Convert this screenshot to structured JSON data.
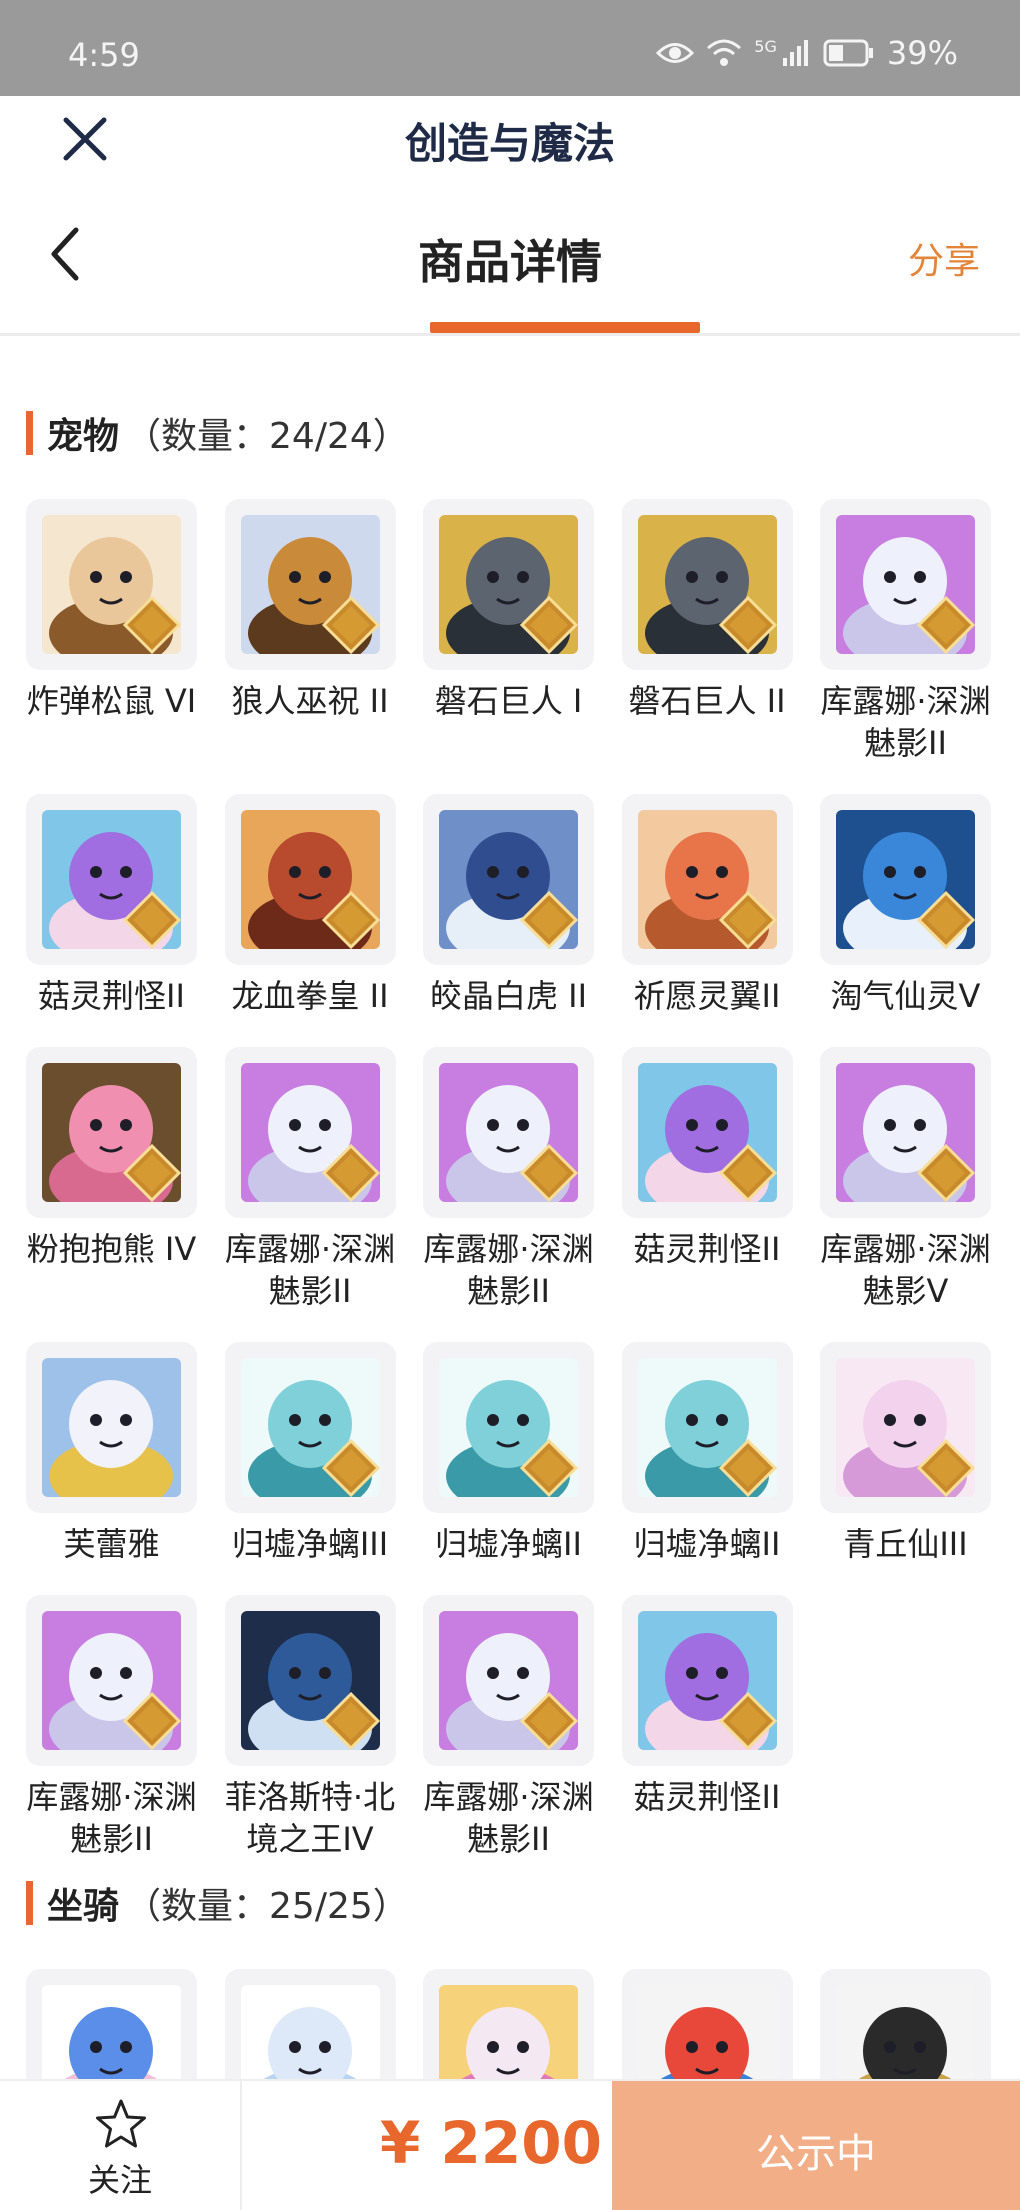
{
  "status_bar": {
    "time": "4:59",
    "network": "5G",
    "battery": "39%"
  },
  "app_bar": {
    "title": "创造与魔法"
  },
  "nav": {
    "title": "商品详情",
    "share": "分享"
  },
  "colors": {
    "accent": "#e8672c",
    "share": "#e2843a",
    "status_bar_bg": "#9a9a9a",
    "tile_bg": "#f3f3f5",
    "cta_bg": "#f2ae86"
  },
  "pets": {
    "title": "宠物",
    "count": "（数量：24/24）",
    "items": [
      {
        "name": "炸弹松鼠 VI",
        "level": "VI",
        "icon": "squirrel-icon"
      },
      {
        "name": "狼人巫祝 II",
        "level": "II",
        "icon": "werewolf-icon"
      },
      {
        "name": "磐石巨人 I",
        "level": "I",
        "icon": "rock-giant-icon"
      },
      {
        "name": "磐石巨人 II",
        "level": "II",
        "icon": "rock-giant-icon"
      },
      {
        "name": "库露娜·深渊魅影II",
        "level": "II",
        "icon": "kuluna-icon"
      },
      {
        "name": "菇灵荆怪II",
        "level": "II",
        "icon": "mushroom-spirit-icon"
      },
      {
        "name": "龙血拳皇 II",
        "level": "II",
        "icon": "dragon-blood-icon"
      },
      {
        "name": "皎晶白虎 II",
        "level": "II",
        "icon": "white-tiger-icon"
      },
      {
        "name": "祈愿灵翼II",
        "level": "II",
        "icon": "spirit-wing-icon"
      },
      {
        "name": "淘气仙灵V",
        "level": "V",
        "icon": "fairy-pup-icon"
      },
      {
        "name": "粉抱抱熊 IV",
        "level": "IV",
        "icon": "pink-bear-icon"
      },
      {
        "name": "库露娜·深渊魅影II",
        "level": "II",
        "icon": "kuluna-icon"
      },
      {
        "name": "库露娜·深渊魅影II",
        "level": "II",
        "icon": "kuluna-icon"
      },
      {
        "name": "菇灵荆怪II",
        "level": "II",
        "icon": "mushroom-spirit-icon"
      },
      {
        "name": "库露娜·深渊魅影V",
        "level": "V",
        "icon": "kuluna-icon"
      },
      {
        "name": "芙蕾雅",
        "level": "",
        "icon": "freya-icon"
      },
      {
        "name": "归墟净螭III",
        "level": "III",
        "icon": "jade-dragon-icon"
      },
      {
        "name": "归墟净螭II",
        "level": "II",
        "icon": "jade-dragon-icon"
      },
      {
        "name": "归墟净螭II",
        "level": "II",
        "icon": "jade-dragon-icon"
      },
      {
        "name": "青丘仙III",
        "level": "III",
        "icon": "fox-fairy-icon"
      },
      {
        "name": "库露娜·深渊魅影II",
        "level": "II",
        "icon": "kuluna-icon"
      },
      {
        "name": "菲洛斯特·北境之王IV",
        "level": "IV",
        "icon": "frost-king-icon"
      },
      {
        "name": "库露娜·深渊魅影II",
        "level": "II",
        "icon": "kuluna-icon"
      },
      {
        "name": "菇灵荆怪II",
        "level": "II",
        "icon": "mushroom-spirit-icon"
      }
    ]
  },
  "mounts": {
    "title": "坐骑",
    "count": "（数量：25/25）",
    "items": [
      {
        "icon": "skateboard-icon"
      },
      {
        "icon": "cloud-icon"
      },
      {
        "icon": "unicorn-icon"
      },
      {
        "icon": "bird-mount-icon"
      },
      {
        "icon": "golden-beast-icon"
      }
    ]
  },
  "bottom": {
    "follow": "关注",
    "price": "¥ 2200",
    "status": "公示中"
  }
}
